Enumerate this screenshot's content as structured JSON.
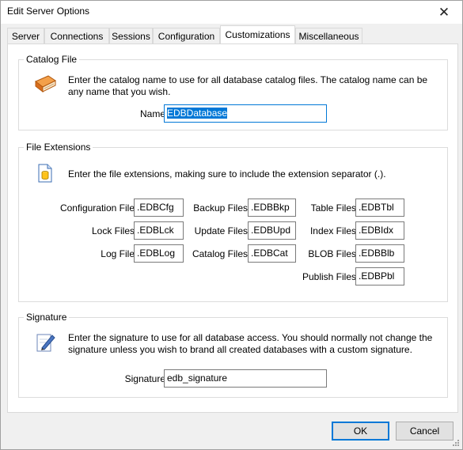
{
  "window": {
    "title": "Edit Server Options"
  },
  "tabs": [
    {
      "label": "Server"
    },
    {
      "label": "Connections"
    },
    {
      "label": "Sessions"
    },
    {
      "label": "Configuration"
    },
    {
      "label": "Customizations"
    },
    {
      "label": "Miscellaneous"
    }
  ],
  "catalog": {
    "group_label": "Catalog File",
    "description": "Enter the catalog name to use for all database catalog files.  The catalog name can be any name that you wish.",
    "name_label": "Name",
    "name_value": "EDBDatabase"
  },
  "extensions": {
    "group_label": "File Extensions",
    "description": "Enter the file extensions, making sure to include the extension separator (.).",
    "fields": [
      {
        "label": "Configuration File",
        "value": ".EDBCfg"
      },
      {
        "label": "Backup Files",
        "value": ".EDBBkp"
      },
      {
        "label": "Table Files",
        "value": ".EDBTbl"
      },
      {
        "label": "Lock Files",
        "value": ".EDBLck"
      },
      {
        "label": "Update Files",
        "value": ".EDBUpd"
      },
      {
        "label": "Index Files",
        "value": ".EDBIdx"
      },
      {
        "label": "Log File",
        "value": ".EDBLog"
      },
      {
        "label": "Catalog Files",
        "value": ".EDBCat"
      },
      {
        "label": "BLOB Files",
        "value": ".EDBBlb"
      },
      {
        "label": "Publish Files",
        "value": ".EDBPbl"
      }
    ]
  },
  "signature": {
    "group_label": "Signature",
    "description": "Enter the signature to use for all database access.  You should normally not change the signature unless you wish to brand all created databases with a custom signature.",
    "label": "Signature",
    "value": "edb_signature"
  },
  "buttons": {
    "ok": "OK",
    "cancel": "Cancel"
  },
  "icons": {
    "close": "close-icon",
    "catalog": "book-icon",
    "extensions": "file-database-icon",
    "signature": "pen-icon"
  },
  "colors": {
    "accent": "#0078d7",
    "book": "#e8822a"
  }
}
